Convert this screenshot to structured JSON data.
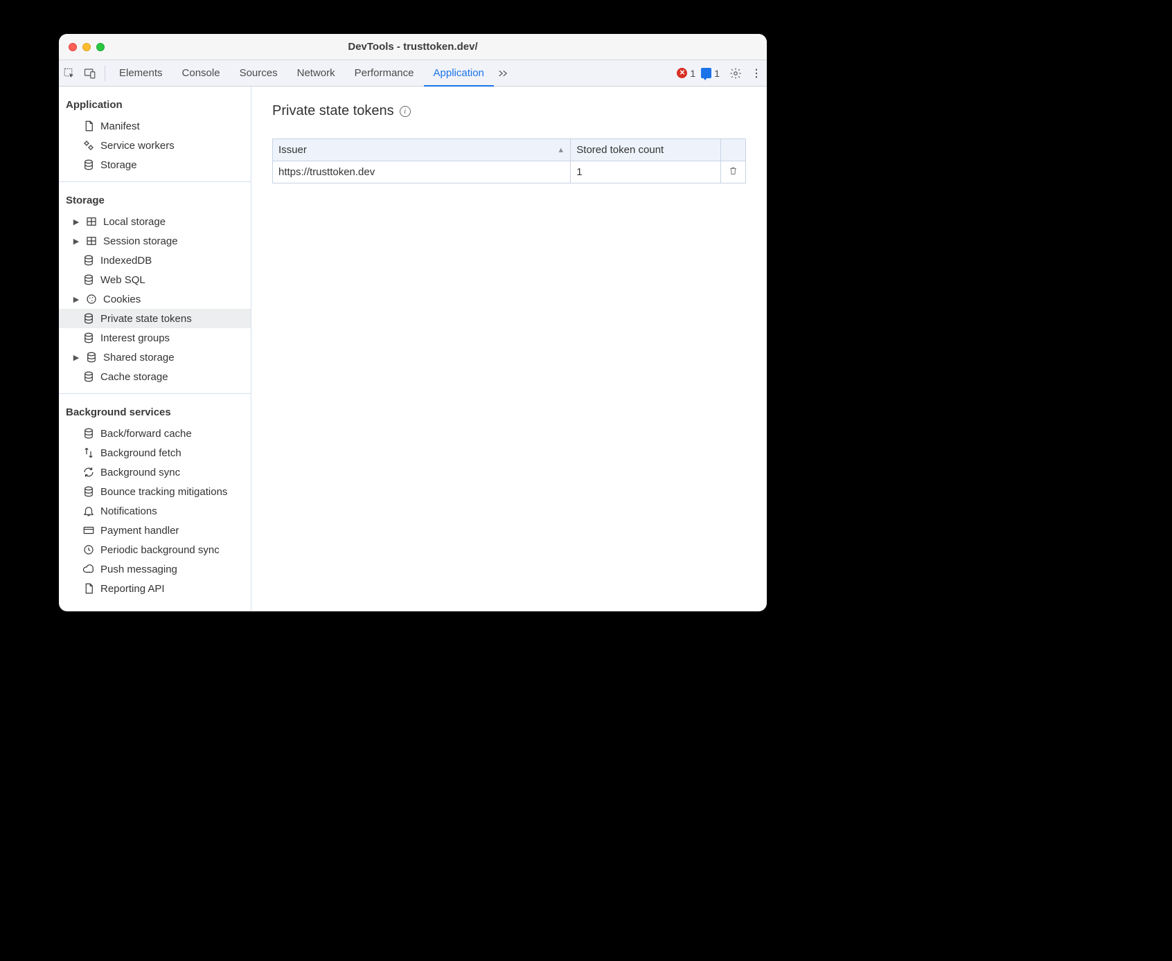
{
  "window": {
    "title": "DevTools - trusttoken.dev/"
  },
  "toolbar": {
    "tabs": [
      "Elements",
      "Console",
      "Sources",
      "Network",
      "Performance",
      "Application"
    ],
    "active_tab": "Application",
    "error_count": "1",
    "message_count": "1"
  },
  "sidebar": {
    "sections": [
      {
        "title": "Application",
        "items": [
          "Manifest",
          "Service workers",
          "Storage"
        ]
      },
      {
        "title": "Storage",
        "items": [
          "Local storage",
          "Session storage",
          "IndexedDB",
          "Web SQL",
          "Cookies",
          "Private state tokens",
          "Interest groups",
          "Shared storage",
          "Cache storage"
        ],
        "selected": "Private state tokens",
        "expandable": [
          "Local storage",
          "Session storage",
          "Cookies",
          "Shared storage"
        ]
      },
      {
        "title": "Background services",
        "items": [
          "Back/forward cache",
          "Background fetch",
          "Background sync",
          "Bounce tracking mitigations",
          "Notifications",
          "Payment handler",
          "Periodic background sync",
          "Push messaging",
          "Reporting API"
        ]
      }
    ]
  },
  "main": {
    "title": "Private state tokens",
    "table": {
      "columns": [
        "Issuer",
        "Stored token count"
      ],
      "sort_column": "Issuer",
      "sort_direction": "asc",
      "rows": [
        {
          "issuer": "https://trusttoken.dev",
          "count": "1"
        }
      ]
    }
  }
}
